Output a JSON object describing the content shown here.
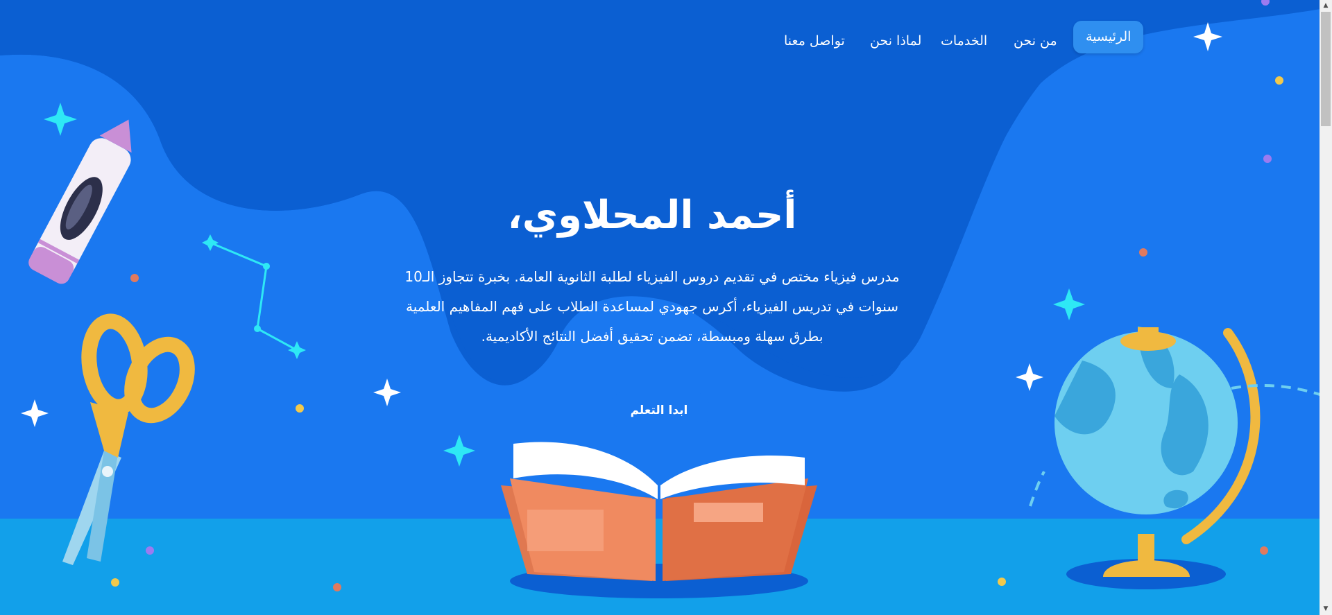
{
  "nav": {
    "items": [
      {
        "label": "الرئيسية",
        "active": true
      },
      {
        "label": "من نحن",
        "active": false
      },
      {
        "label": "الخدمات",
        "active": false
      },
      {
        "label": "لماذا نحن",
        "active": false
      },
      {
        "label": "تواصل معنا",
        "active": false
      }
    ]
  },
  "hero": {
    "title": "أحمد المحلاوي،",
    "description": "مدرس فيزياء مختص في تقديم دروس الفيزياء لطلبة الثانوية العامة. بخبرة تتجاوز الـ10 سنوات في تدريس الفيزياء، أكرس جهودي لمساعدة الطلاب على فهم المفاهيم العلمية بطرق سهلة ومبسطة، تضمن تحقيق أفضل النتائج الأكاديمية.",
    "cta_label": "ابدا التعلم"
  },
  "colors": {
    "background": "#0b5fd2",
    "wave": "#1a78f0",
    "floor": "#12a0ea",
    "accent_cyan": "#2ee8f5",
    "button": "#1a78f0"
  },
  "icons": {
    "logo": "sparkle-star-icon",
    "decor": [
      "crayon",
      "scissors",
      "open-book",
      "globe",
      "constellation",
      "sparkle-star"
    ]
  }
}
